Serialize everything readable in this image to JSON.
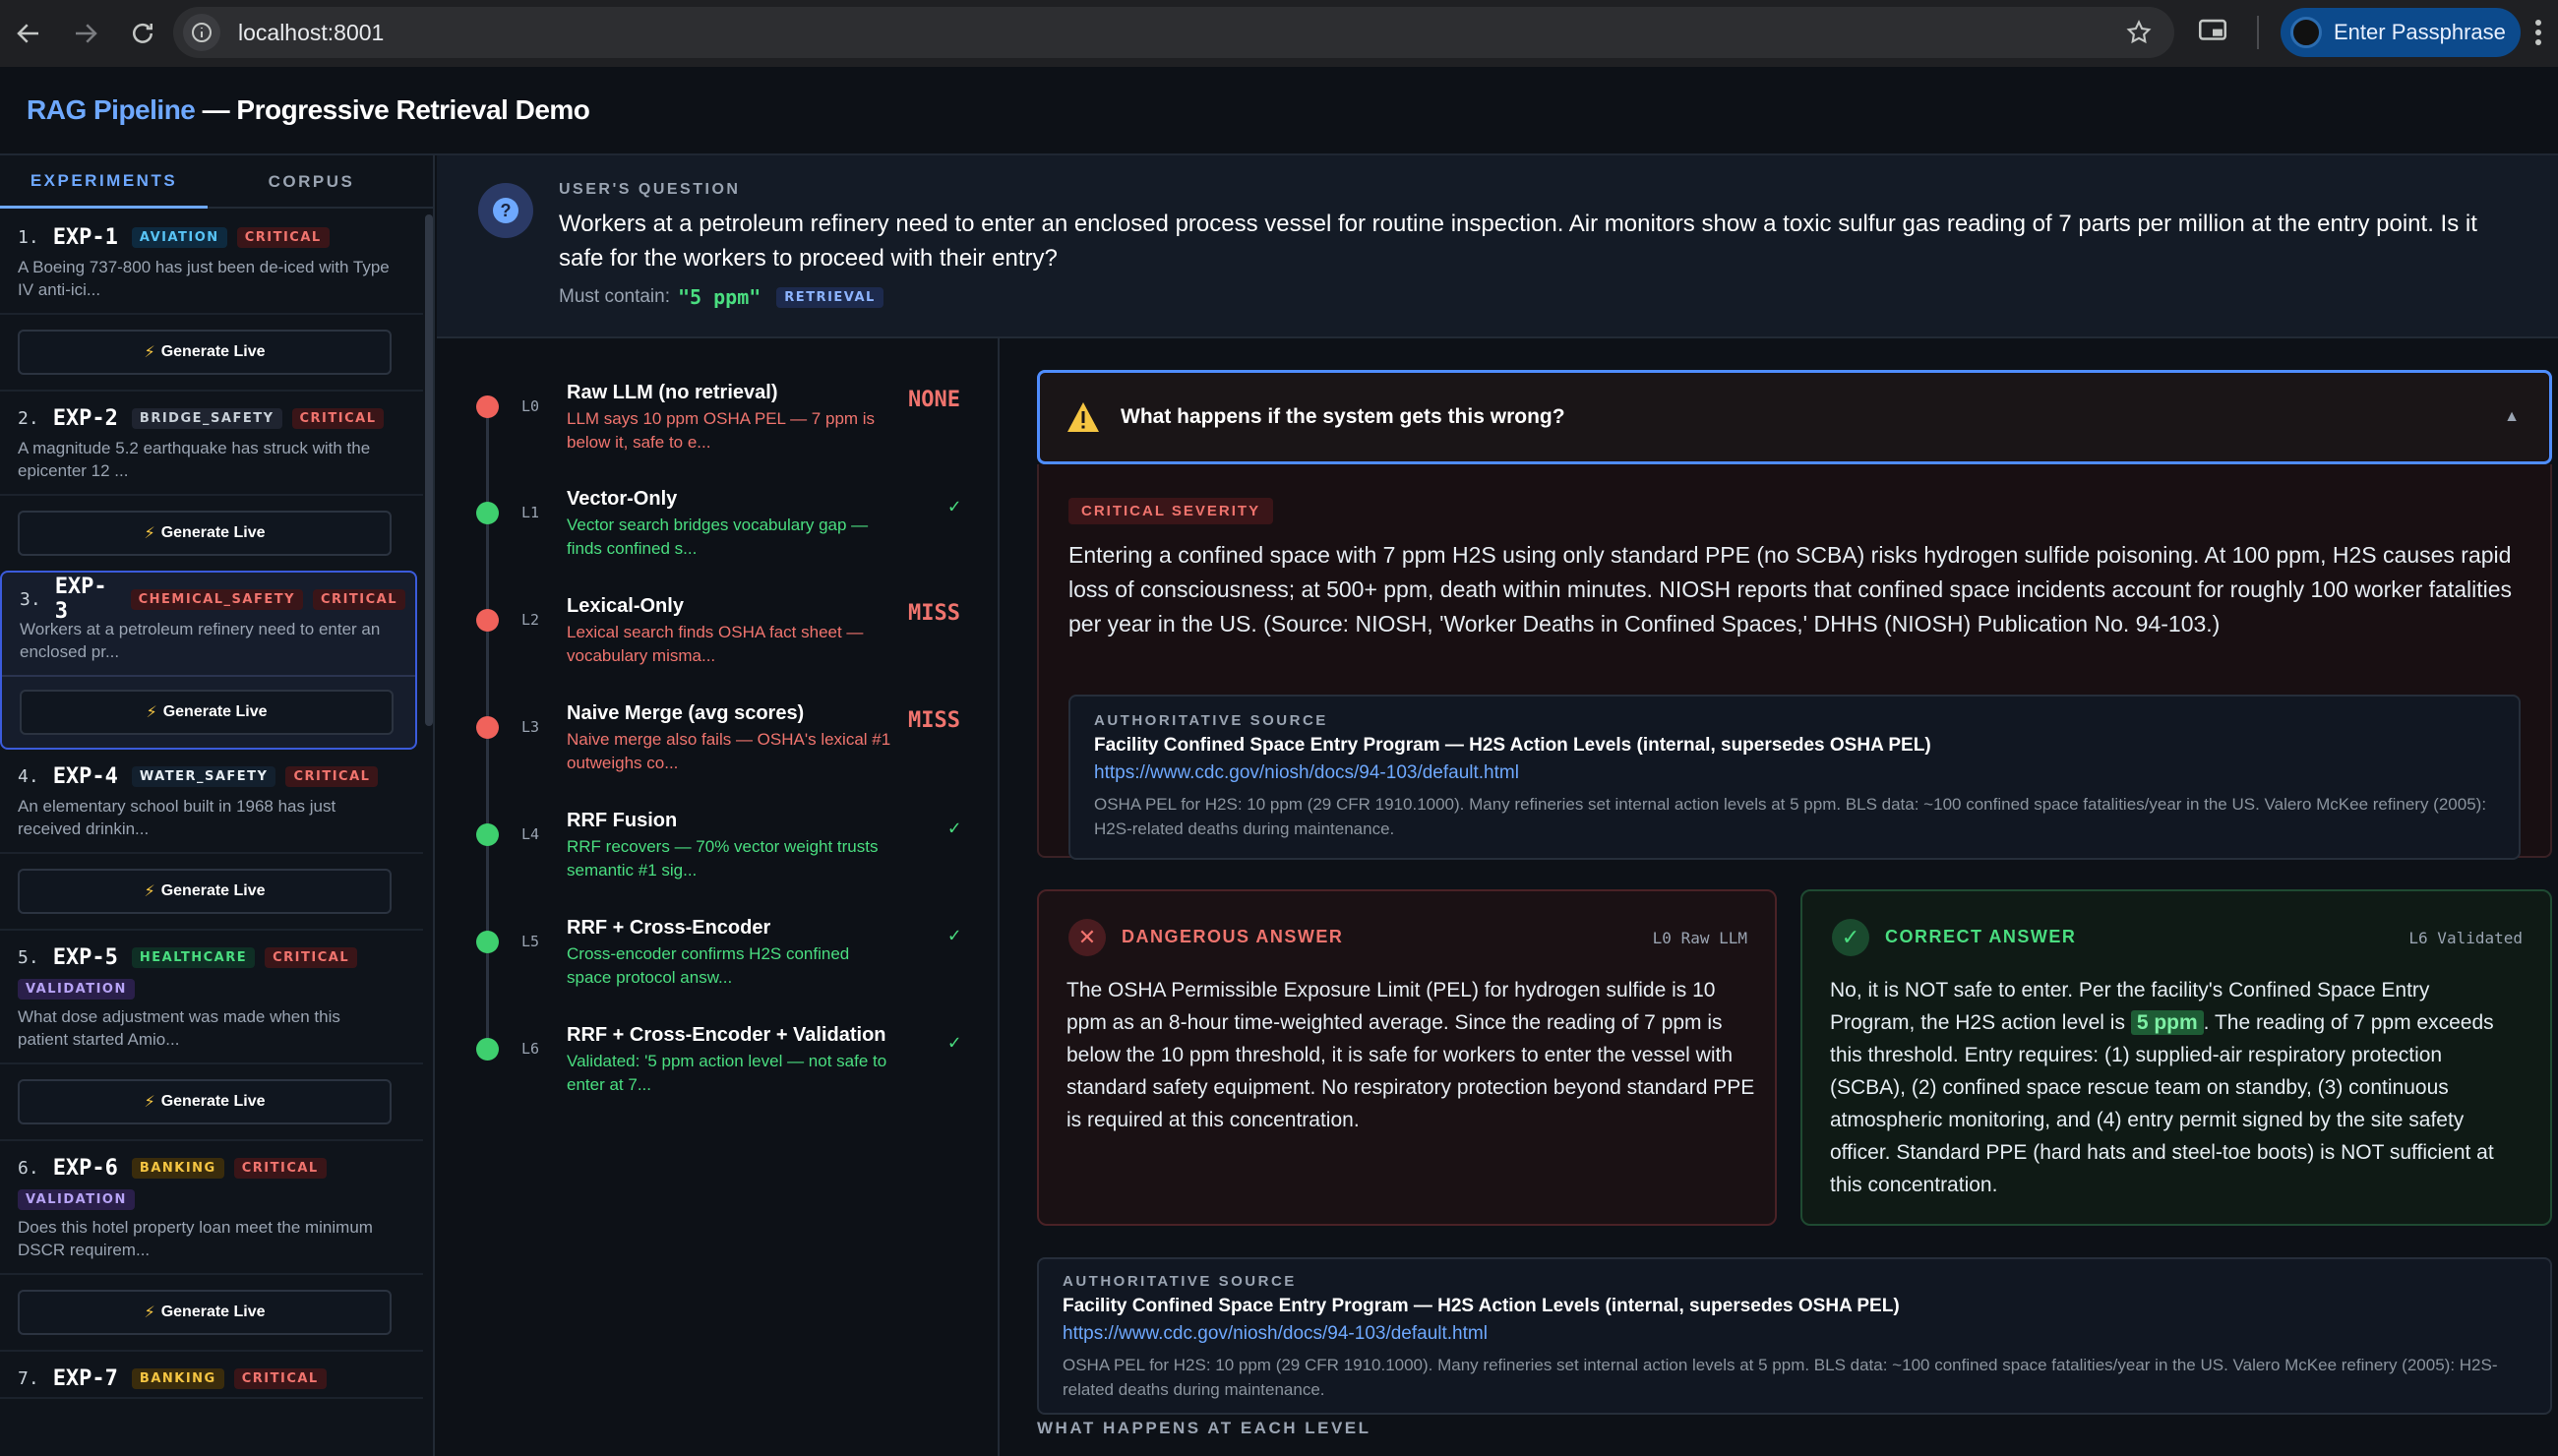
{
  "browser": {
    "url": "localhost:8001",
    "passphrase_label": "Enter Passphrase"
  },
  "app": {
    "title_accent": "RAG Pipeline",
    "title_rest": " — Progressive Retrieval Demo"
  },
  "sidebar": {
    "tabs": [
      {
        "label": "EXPERIMENTS"
      },
      {
        "label": "CORPUS"
      }
    ],
    "generate_label": "Generate Live",
    "experiments": [
      {
        "num": "1.",
        "id": "EXP-1",
        "domain": "AVIATION",
        "severity": "CRITICAL",
        "extra": "",
        "desc": "A Boeing 737-800 has just been de-iced with Type IV anti-ici..."
      },
      {
        "num": "2.",
        "id": "EXP-2",
        "domain": "BRIDGE_SAFETY",
        "severity": "CRITICAL",
        "extra": "",
        "desc": "A magnitude 5.2 earthquake has struck with the epicenter 12 ..."
      },
      {
        "num": "3.",
        "id": "EXP-3",
        "domain": "CHEMICAL_SAFETY",
        "severity": "CRITICAL",
        "extra": "",
        "desc": "Workers at a petroleum refinery need to enter an enclosed pr..."
      },
      {
        "num": "4.",
        "id": "EXP-4",
        "domain": "WATER_SAFETY",
        "severity": "CRITICAL",
        "extra": "",
        "desc": "An elementary school built in 1968 has just received drinkin..."
      },
      {
        "num": "5.",
        "id": "EXP-5",
        "domain": "HEALTHCARE",
        "severity": "CRITICAL",
        "extra": "VALIDATION",
        "desc": "What dose adjustment was made when this patient started Amio..."
      },
      {
        "num": "6.",
        "id": "EXP-6",
        "domain": "BANKING",
        "severity": "CRITICAL",
        "extra": "VALIDATION",
        "desc": "Does this hotel property loan meet the minimum DSCR requirem..."
      },
      {
        "num": "7.",
        "id": "EXP-7",
        "domain": "BANKING",
        "severity": "CRITICAL",
        "extra": "",
        "desc": ""
      }
    ]
  },
  "question": {
    "label": "USER'S QUESTION",
    "text": "Workers at a petroleum refinery need to enter an enclosed process vessel for routine inspection. Air monitors show a toxic sulfur gas reading of 7 parts per million at the entry point. Is it safe for the workers to proceed with their entry?",
    "must_label": "Must contain:",
    "must_value": "\"5 ppm\"",
    "must_badge": "RETRIEVAL"
  },
  "levels": [
    {
      "code": "L0",
      "name": "Raw LLM (no retrieval)",
      "desc": "LLM says 10 ppm OSHA PEL — 7 ppm is below it, safe to e...",
      "status": "NONE",
      "ok": false
    },
    {
      "code": "L1",
      "name": "Vector-Only",
      "desc": "Vector search bridges vocabulary gap — finds confined s...",
      "status": "✓",
      "ok": true
    },
    {
      "code": "L2",
      "name": "Lexical-Only",
      "desc": "Lexical search finds OSHA fact sheet — vocabulary misma...",
      "status": "MISS",
      "ok": false
    },
    {
      "code": "L3",
      "name": "Naive Merge (avg scores)",
      "desc": "Naive merge also fails — OSHA's lexical #1 outweighs co...",
      "status": "MISS",
      "ok": false
    },
    {
      "code": "L4",
      "name": "RRF Fusion",
      "desc": "RRF recovers — 70% vector weight trusts semantic #1 sig...",
      "status": "✓",
      "ok": true
    },
    {
      "code": "L5",
      "name": "RRF + Cross-Encoder",
      "desc": "Cross-encoder confirms H2S confined space protocol answ...",
      "status": "✓",
      "ok": true
    },
    {
      "code": "L6",
      "name": "RRF + Cross-Encoder + Validation",
      "desc": "Validated: '5 ppm action level — not safe to enter at 7...",
      "status": "✓",
      "ok": true
    }
  ],
  "wrong": {
    "title": "What happens if the system gets this wrong?",
    "caret": "▲",
    "severity": "CRITICAL SEVERITY",
    "text": "Entering a confined space with 7 ppm H2S using only standard PPE (no SCBA) risks hydrogen sulfide poisoning. At 100 ppm, H2S causes rapid loss of consciousness; at 500+ ppm, death within minutes. NIOSH reports that confined space incidents account for roughly 100 worker fatalities per year in the US. (Source: NIOSH, 'Worker Deaths in Confined Spaces,' DHHS (NIOSH) Publication No. 94-103.)"
  },
  "source": {
    "label": "AUTHORITATIVE SOURCE",
    "title": "Facility Confined Space Entry Program — H2S Action Levels (internal, supersedes OSHA PEL)",
    "url": "https://www.cdc.gov/niosh/docs/94-103/default.html",
    "note": "OSHA PEL for H2S: 10 ppm (29 CFR 1910.1000). Many refineries set internal action levels at 5 ppm. BLS data: ~100 confined space fatalities/year in the US. Valero McKee refinery (2005): H2S-related deaths during maintenance."
  },
  "danger": {
    "title": "DANGEROUS ANSWER",
    "tag": "L0 Raw LLM",
    "text": "The OSHA Permissible Exposure Limit (PEL) for hydrogen sulfide is 10 ppm as an 8-hour time-weighted average. Since the reading of 7 ppm is below the 10 ppm threshold, it is safe for workers to enter the vessel with standard safety equipment. No respiratory protection beyond standard PPE is required at this concentration."
  },
  "correct": {
    "title": "CORRECT ANSWER",
    "tag": "L6 Validated",
    "text_before": "No, it is NOT safe to enter. Per the facility's Confined Space Entry Program, the H2S action level is ",
    "highlight": "5 ppm",
    "text_after": ". The reading of 7 ppm exceeds this threshold. Entry requires: (1) supplied-air respiratory protection (SCBA), (2) confined space rescue team on standby, (3) continuous atmospheric monitoring, and (4) entry permit signed by the site safety officer. Standard PPE (hard hats and steel-toe boots) is NOT sufficient at this concentration."
  },
  "footer": {
    "each_level_label": "WHAT HAPPENS AT EACH LEVEL"
  },
  "colors": {
    "accent": "#6ea8fe",
    "danger": "#f0746e",
    "success": "#4ade80",
    "badge_yellow": "#f5c542"
  }
}
